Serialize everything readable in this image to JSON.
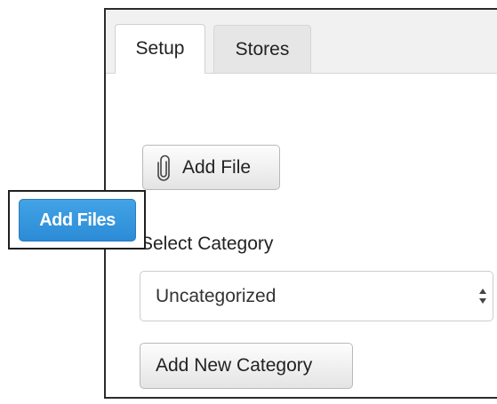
{
  "tabs": [
    {
      "label": "Setup",
      "active": true
    },
    {
      "label": "Stores",
      "active": false
    }
  ],
  "buttons": {
    "add_file": "Add File",
    "add_files_highlight": "Add Files",
    "add_new_category": "Add New Category"
  },
  "category": {
    "label": "Select Category",
    "selected": "Uncategorized"
  },
  "icons": {
    "add_file": "paperclip-icon",
    "select": "up-down-arrows-icon"
  },
  "colors": {
    "accent": "#3498db",
    "active_tab_bg": "#ffffff",
    "inactive_tab_bg": "#e6e6e6"
  }
}
